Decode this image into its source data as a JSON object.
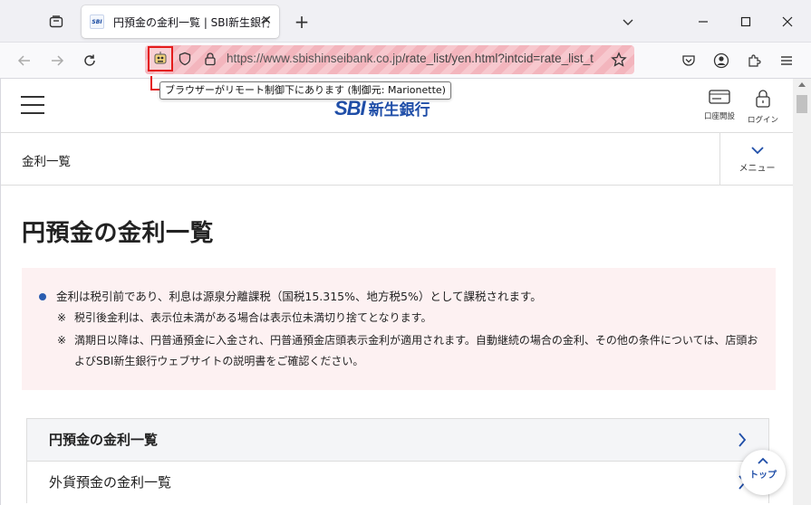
{
  "browser": {
    "tab_title": "円預金の金利一覧 | SBI新生銀行",
    "tab_favicon_text": "SBI",
    "url_host": "https://www.sbishinseibank.co.jp",
    "url_path": "/rate_list/yen.html?intcid=rate_list_t",
    "remote_tooltip": "ブラウザーがリモート制御下にあります (制御元: Marionette)",
    "icons": {
      "tab_list": "tab-list-icon",
      "back": "back-arrow-icon",
      "forward": "forward-arrow-icon",
      "reload": "reload-icon",
      "robot": "robot-icon",
      "shield": "shield-icon",
      "lock": "lock-icon",
      "star": "star-icon",
      "pocket": "pocket-icon",
      "account": "account-icon",
      "extensions": "extensions-icon",
      "menu": "hamburger-menu-icon"
    },
    "colors": {
      "remote_stripe": "#f7c8ce",
      "robot_border": "#e41b1b"
    }
  },
  "site": {
    "logo_sbi": "SBI",
    "logo_name": "新生銀行",
    "account_open_label": "口座開設",
    "login_label": "ログイン",
    "breadcrumb": "金利一覧",
    "menu_label": "メニュー",
    "brand_color": "#1f4ea8"
  },
  "main": {
    "title": "円預金の金利一覧",
    "notice": {
      "main": "金利は税引前であり、利息は源泉分離課税（国税15.315%、地方税5%）として課税されます。",
      "notes": [
        {
          "mark": "※",
          "text": "税引後金利は、表示位未満がある場合は表示位未満切り捨てとなります。"
        },
        {
          "mark": "※",
          "text": "満期日以降は、円普通預金に入金され、円普通預金店頭表示金利が適用されます。自動継続の場合の金利、その他の条件については、店頭およびSBI新生銀行ウェブサイトの説明書をご確認ください。"
        }
      ],
      "background": "#fdf1f2"
    },
    "rate_links": [
      {
        "label": "円預金の金利一覧"
      },
      {
        "label": "外貨預金の金利一覧"
      }
    ],
    "to_top_label": "トップ"
  }
}
